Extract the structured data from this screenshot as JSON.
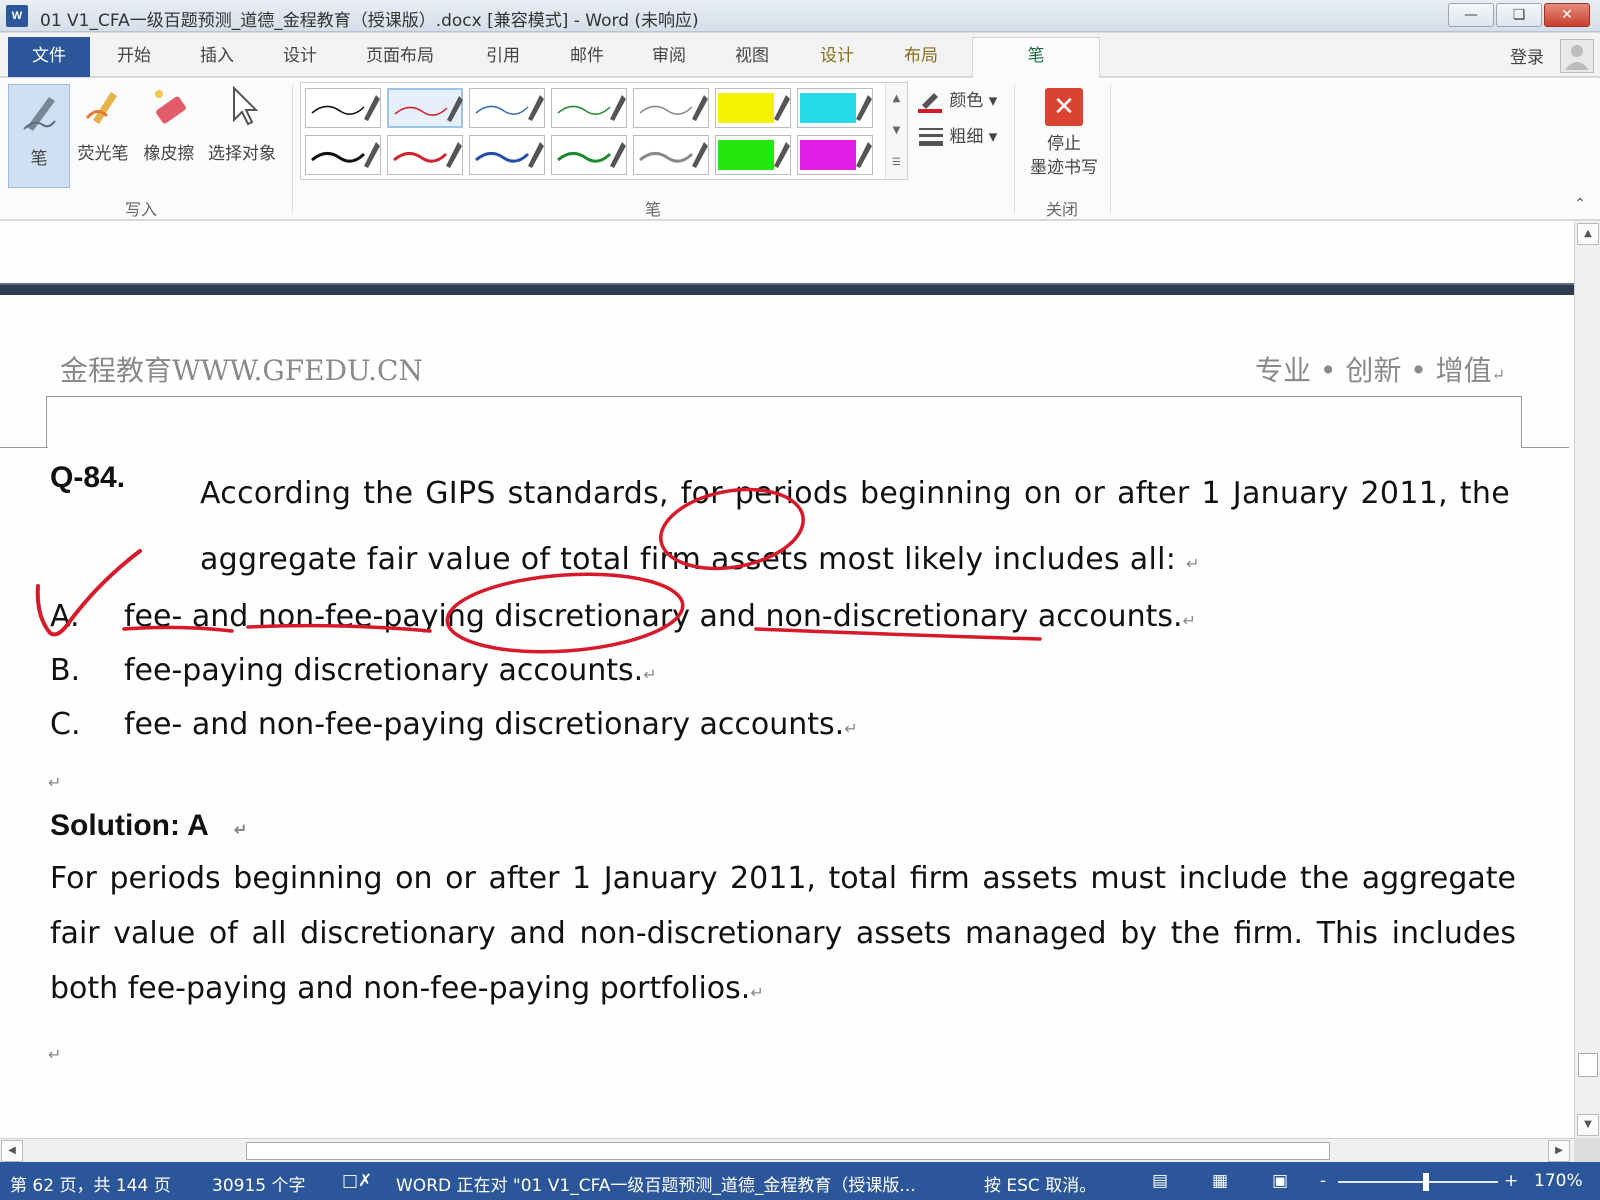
{
  "window": {
    "title": "01 V1_CFA一级百题预测_道德_金程教育（授课版）.docx [兼容模式] - Word (未响应)",
    "app_icon_letter": "W"
  },
  "tabs": {
    "file": "文件",
    "items": [
      "开始",
      "插入",
      "设计",
      "页面布局",
      "引用",
      "邮件",
      "审阅",
      "视图",
      "设计",
      "布局"
    ],
    "active": "笔",
    "login": "登录"
  },
  "ribbon": {
    "write_group": {
      "label": "写入",
      "tools": [
        "笔",
        "荧光笔",
        "橡皮擦",
        "选择对象"
      ]
    },
    "pen_group": {
      "label": "笔",
      "color_label": "颜色",
      "weight_label": "粗细",
      "swatches_row1": [
        "#111111",
        "#d2242f",
        "#3a6fb4",
        "#2a8a3e",
        "#888888",
        "#f5f200",
        "#26d9e6"
      ],
      "swatches_row2": [
        "#111111",
        "#d2242f",
        "#2250a8",
        "#1a8a2a",
        "#888888",
        "#26e60f",
        "#e31ee6"
      ]
    },
    "close_group": {
      "label": "关闭",
      "stop_button": "停止\n墨迹书写"
    }
  },
  "document": {
    "header_left": "金程教育WWW.GFEDU.CN",
    "header_right": "专业 • 创新 • 增值",
    "question_number": "Q-84.",
    "question_text": "According the GIPS standards, for periods beginning on or after 1 January 2011, the aggregate fair value of total firm assets most likely includes all:",
    "options": [
      {
        "letter": "A.",
        "text": "fee- and non-fee-paying discretionary and non-discretionary accounts."
      },
      {
        "letter": "B.",
        "text": "fee-paying discretionary accounts."
      },
      {
        "letter": "C.",
        "text": "fee- and non-fee-paying discretionary accounts."
      }
    ],
    "solution_title": "Solution: A",
    "solution_text": "For periods beginning on or after 1 January 2011, total firm assets must include the aggregate fair value of all discretionary and non-discretionary assets managed by the firm. This includes both fee-paying and non-fee-paying portfolios.",
    "paragraph_mark": "↵",
    "ink_color": "#d61a2a"
  },
  "statusbar": {
    "page": "第 62 页，共 144 页",
    "words": "30915 个字",
    "progress": "WORD 正在对 \"01 V1_CFA一级百题预测_道德_金程教育（授课版...",
    "esc": "按 ESC 取消。",
    "zoom_minus": "-",
    "zoom_plus": "+",
    "zoom": "170%",
    "zoom_level": 0.55
  }
}
